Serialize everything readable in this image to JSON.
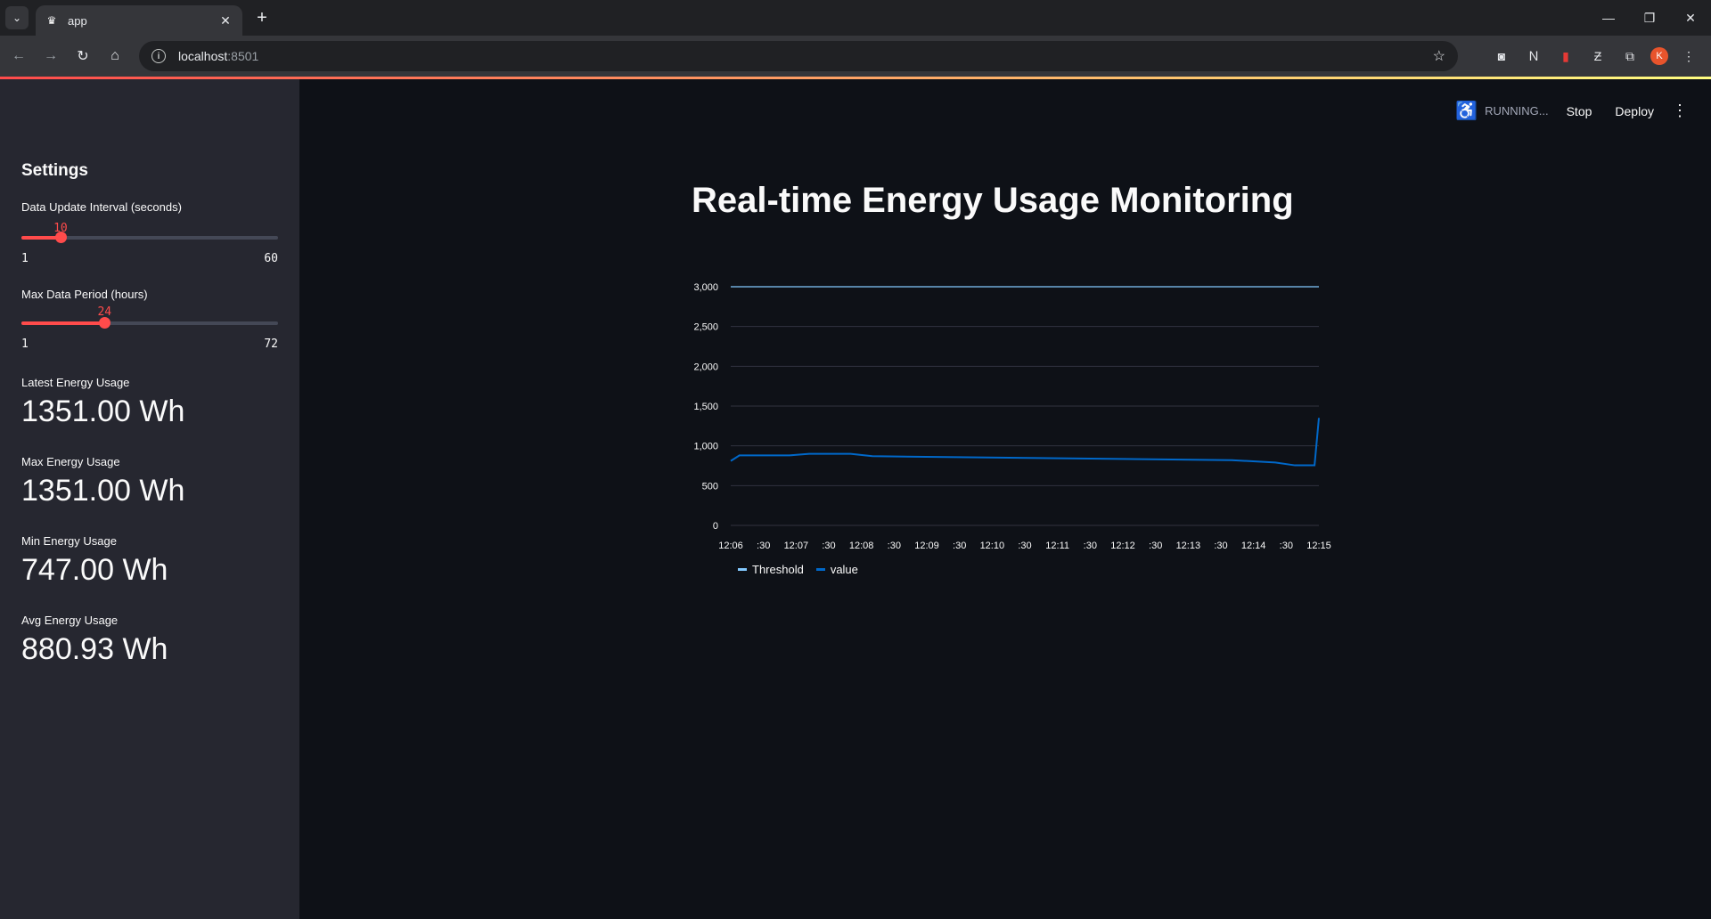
{
  "browser": {
    "tab_title": "app",
    "url_host": "localhost",
    "url_port": ":8501",
    "avatar_letter": "K"
  },
  "header": {
    "status": "RUNNING...",
    "stop_label": "Stop",
    "deploy_label": "Deploy"
  },
  "sidebar": {
    "title": "Settings",
    "sliders": [
      {
        "label": "Data Update Interval (seconds)",
        "value": 10,
        "min": 1,
        "max": 60,
        "value_text": "10",
        "min_text": "1",
        "max_text": "60"
      },
      {
        "label": "Max Data Period (hours)",
        "value": 24,
        "min": 1,
        "max": 72,
        "value_text": "24",
        "min_text": "1",
        "max_text": "72"
      }
    ],
    "metrics": [
      {
        "label": "Latest Energy Usage",
        "value": "1351.00 Wh"
      },
      {
        "label": "Max Energy Usage",
        "value": "1351.00 Wh"
      },
      {
        "label": "Min Energy Usage",
        "value": "747.00 Wh"
      },
      {
        "label": "Avg Energy Usage",
        "value": "880.93 Wh"
      }
    ]
  },
  "main": {
    "title": "Real-time Energy Usage Monitoring"
  },
  "colors": {
    "accent": "#ff4b4b",
    "threshold": "#83c9ff",
    "value": "#0068c9"
  },
  "chart_data": {
    "type": "line",
    "title": "",
    "xlabel": "",
    "ylabel": "",
    "ylim": [
      0,
      3000
    ],
    "y_ticks": [
      "3,000",
      "2,500",
      "2,000",
      "1,500",
      "1,000",
      "500",
      "0"
    ],
    "y_tick_values": [
      3000,
      2500,
      2000,
      1500,
      1000,
      500,
      0
    ],
    "x_ticks": [
      "12:06",
      ":30",
      "12:07",
      ":30",
      "12:08",
      ":30",
      "12:09",
      ":30",
      "12:10",
      ":30",
      "12:11",
      ":30",
      "12:12",
      ":30",
      "12:13",
      ":30",
      "12:14",
      ":30",
      "12:15"
    ],
    "xlim_seconds": [
      0,
      540
    ],
    "grid": true,
    "legend_position": "bottom-left",
    "series": [
      {
        "name": "Threshold",
        "x": [
          0,
          560
        ],
        "values": [
          3000,
          3000
        ]
      },
      {
        "name": "value",
        "x": [
          -6,
          8,
          24,
          40,
          54,
          72,
          90,
          110,
          130,
          460,
          500,
          518,
          536,
          545
        ],
        "values": [
          810,
          880,
          880,
          880,
          880,
          900,
          900,
          900,
          870,
          820,
          790,
          755,
          755,
          1351
        ]
      }
    ]
  }
}
